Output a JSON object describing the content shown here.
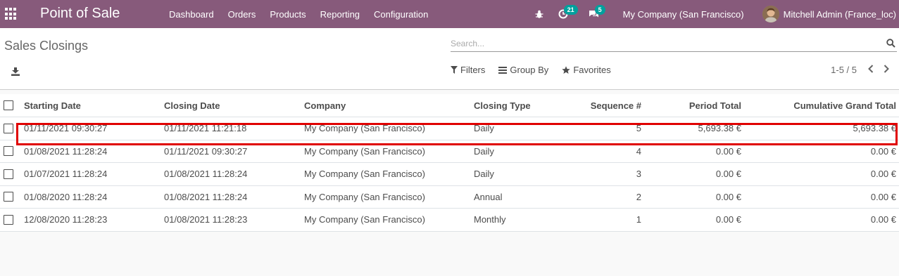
{
  "navbar": {
    "app_title": "Point of Sale",
    "menu": [
      "Dashboard",
      "Orders",
      "Products",
      "Reporting",
      "Configuration"
    ],
    "activity_count": "21",
    "message_count": "5",
    "company": "My Company (San Francisco)",
    "user": "Mitchell Admin (France_loc)",
    "accent_color": "#875a7b",
    "badge_color": "#00a09d"
  },
  "control_panel": {
    "breadcrumb": "Sales Closings",
    "search_placeholder": "Search...",
    "filters_label": "Filters",
    "group_by_label": "Group By",
    "favorites_label": "Favorites",
    "pager": "1-5 / 5"
  },
  "table": {
    "columns": [
      "Starting Date",
      "Closing Date",
      "Company",
      "Closing Type",
      "Sequence #",
      "Period Total",
      "Cumulative Grand Total"
    ],
    "rows": [
      {
        "start": "01/11/2021 09:30:27",
        "close": "01/11/2021 11:21:18",
        "company": "My Company (San Francisco)",
        "type": "Daily",
        "seq": "5",
        "period": "5,693.38 €",
        "cum": "5,693.38 €"
      },
      {
        "start": "01/08/2021 11:28:24",
        "close": "01/11/2021 09:30:27",
        "company": "My Company (San Francisco)",
        "type": "Daily",
        "seq": "4",
        "period": "0.00 €",
        "cum": "0.00 €"
      },
      {
        "start": "01/07/2021 11:28:24",
        "close": "01/08/2021 11:28:24",
        "company": "My Company (San Francisco)",
        "type": "Daily",
        "seq": "3",
        "period": "0.00 €",
        "cum": "0.00 €"
      },
      {
        "start": "01/08/2020 11:28:24",
        "close": "01/08/2021 11:28:24",
        "company": "My Company (San Francisco)",
        "type": "Annual",
        "seq": "2",
        "period": "0.00 €",
        "cum": "0.00 €"
      },
      {
        "start": "12/08/2020 11:28:23",
        "close": "01/08/2021 11:28:23",
        "company": "My Company (San Francisco)",
        "type": "Monthly",
        "seq": "1",
        "period": "0.00 €",
        "cum": "0.00 €"
      }
    ]
  },
  "annotation": {
    "highlight_color": "#e00000"
  }
}
